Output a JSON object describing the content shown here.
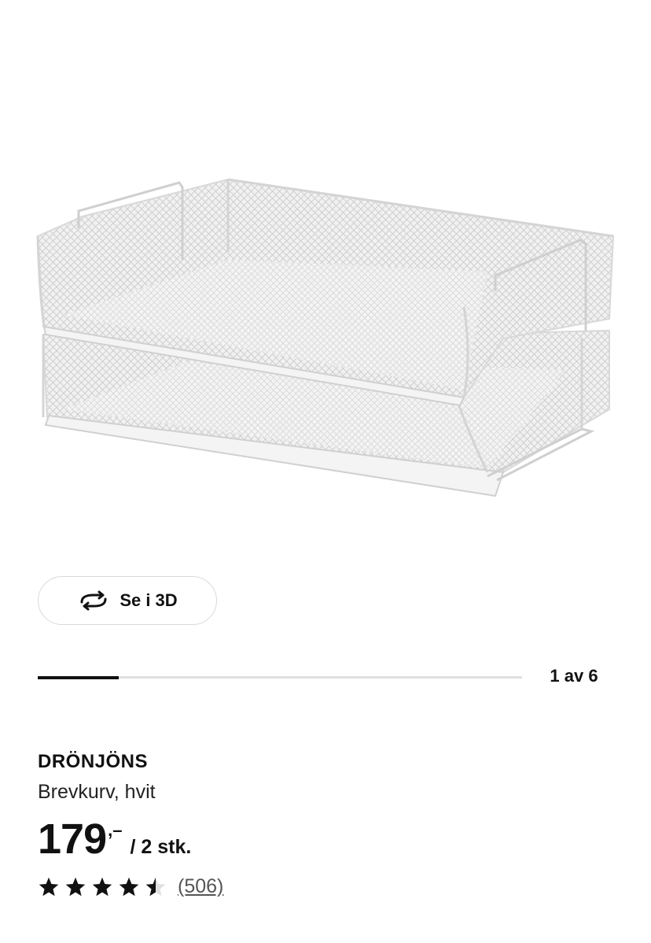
{
  "gallery": {
    "image_alt": "DRÖNJÖNS Brevkurv, hvit",
    "view_3d_label": "Se i 3D",
    "view_3d_icon": "rotate-3d-icon",
    "progress_fraction": 0.1667,
    "counter_text": "1 av 6"
  },
  "product": {
    "name": "DRÖNJÖNS",
    "description": "Brevkurv, hvit",
    "price_integer": "179",
    "price_decimals": ",–",
    "price_unit": "/ 2 stk.",
    "rating_value": 4.5,
    "rating_max": 5,
    "review_count": "(506)"
  },
  "colors": {
    "text": "#111111",
    "track": "#dfdfdf",
    "star_filled": "#111111",
    "star_empty": "#dfdfdf"
  }
}
